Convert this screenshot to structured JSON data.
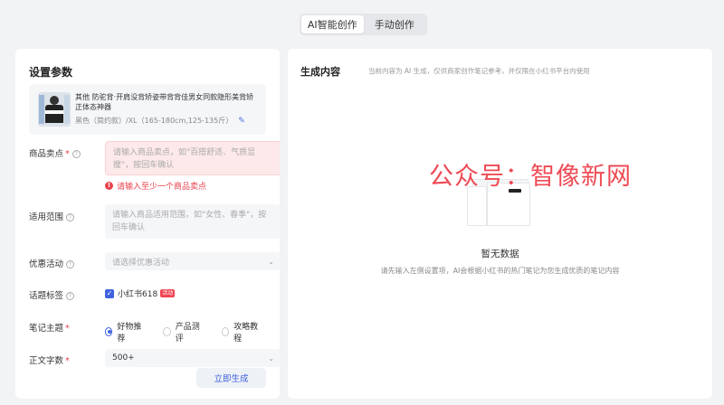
{
  "mode_tabs": [
    {
      "label": "AI智能创作",
      "active": true
    },
    {
      "label": "手动创作",
      "active": false
    }
  ],
  "left_panel": {
    "title": "设置参数",
    "product": {
      "name": "其他 防驼背·开肩没背矫姿带背背佳男女同款隐形美背矫正体态神器",
      "spec": "黑色（简约款）/XL（165-180cm,125-135斤）"
    },
    "selling_points": {
      "label": "商品卖点",
      "placeholder": "请输入商品卖点，如\"百搭舒适、气质显瘦\"，按回车确认",
      "error": "请输入至少一个商品卖点"
    },
    "scope": {
      "label": "适用范围",
      "placeholder": "请输入商品适用范围，如\"女性、春季\"，按回车确认"
    },
    "promotion": {
      "label": "优惠活动",
      "placeholder": "请选择优惠活动"
    },
    "topic_tag": {
      "label": "话题标签",
      "checkbox_label": "小红书618",
      "badge": "活动",
      "checked": true
    },
    "note_theme": {
      "label": "笔记主题",
      "options": [
        "好物推荐",
        "产品测评",
        "攻略教程"
      ],
      "selected": "好物推荐"
    },
    "word_count": {
      "label": "正文字数",
      "value": "500+"
    },
    "generate_button": "立即生成"
  },
  "right_panel": {
    "title": "生成内容",
    "subtitle": "当前内容为 AI 生成，仅供商家创作笔记参考，并仅限在小红书平台内使用",
    "empty_title": "暂无数据",
    "empty_desc": "请先输入左侧设置项，AI会根据小红书的热门笔记为您生成优质的笔记内容"
  },
  "watermark": "公众号：智像新网",
  "colors": {
    "accent": "#3e62e0",
    "error": "#e8424d",
    "watermark": "#ee4a55"
  }
}
